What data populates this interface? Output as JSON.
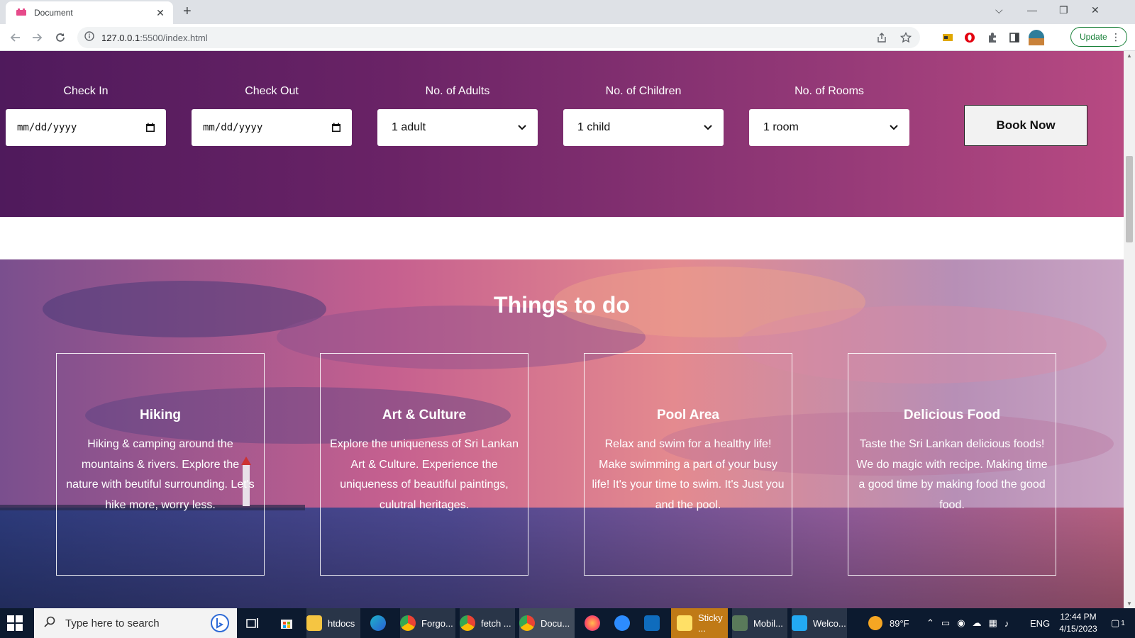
{
  "browser": {
    "tab_title": "Document",
    "url_host": "127.0.0.1",
    "url_path": ":5500/index.html",
    "update_label": "Update"
  },
  "booking": {
    "check_in": {
      "label": "Check In",
      "value": "mm/dd/yyyy"
    },
    "check_out": {
      "label": "Check Out",
      "value": "mm/dd/yyyy"
    },
    "adults": {
      "label": "No. of Adults",
      "value": "1 adult"
    },
    "children": {
      "label": "No. of Children",
      "value": "1 child"
    },
    "rooms": {
      "label": "No. of Rooms",
      "value": "1 room"
    },
    "book_button": "Book Now"
  },
  "things": {
    "title": "Things to do",
    "cards": [
      {
        "title": "Hiking",
        "desc": "Hiking & camping around the mountains & rivers. Explore the nature with beutiful surrounding. Let's hike more, worry less."
      },
      {
        "title": "Art & Culture",
        "desc": "Explore the uniqueness of Sri Lankan Art & Culture. Experience the uniqueness of beautiful paintings, culutral heritages."
      },
      {
        "title": "Pool Area",
        "desc": "Relax and swim for a healthy life! Make swimming a part of your busy life! It's your time to swim. It's Just you and the pool."
      },
      {
        "title": "Delicious Food",
        "desc": "Taste the Sri Lankan delicious foods! We do magic with recipe. Making time a good time by making food the good food."
      }
    ]
  },
  "taskbar": {
    "search_placeholder": "Type here to search",
    "apps": [
      "htdocs",
      "Forgo...",
      "fetch ...",
      "Docu...",
      "Sticky ...",
      "Mobil...",
      "Welco..."
    ],
    "weather": "89°F",
    "language": "ENG",
    "time": "12:44 PM",
    "date": "4/15/2023",
    "notification_count": "1"
  }
}
